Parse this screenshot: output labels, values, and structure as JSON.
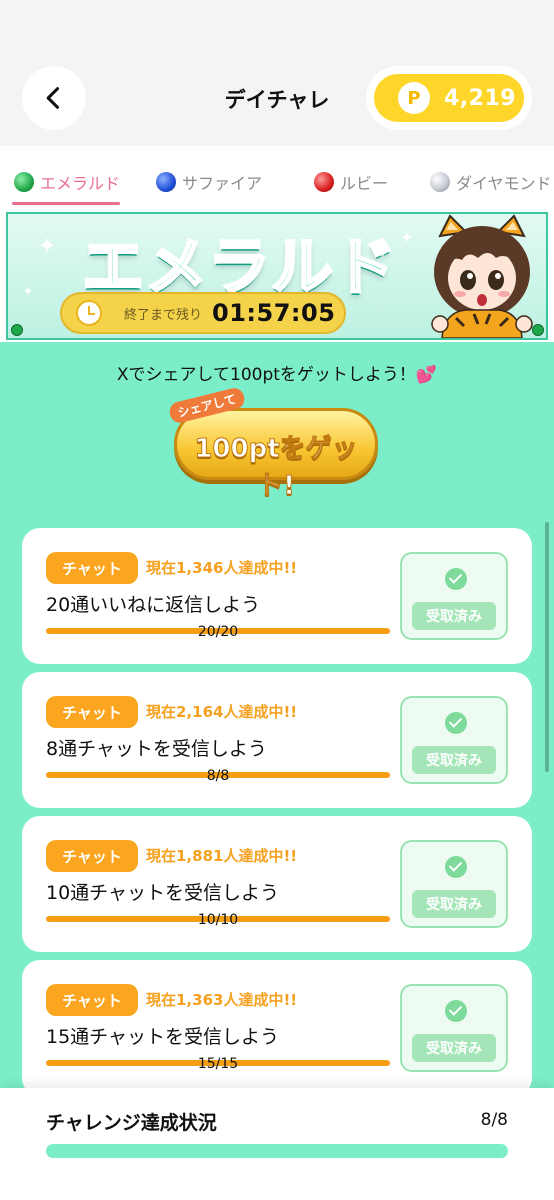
{
  "header": {
    "title": "デイチャレ",
    "back_icon": "chevron-left-icon",
    "points": {
      "icon": "P",
      "value": "4,219"
    }
  },
  "tabs": [
    {
      "label": "エメラルド",
      "gem_color": "#1fa84a",
      "active": true
    },
    {
      "label": "サファイア",
      "gem_color": "#1f4fd6",
      "active": false
    },
    {
      "label": "ルビー",
      "gem_color": "#d81e1e",
      "active": false
    },
    {
      "label": "ダイヤモンド",
      "gem_color": "#b8bcc4",
      "active": false
    }
  ],
  "banner": {
    "title": "エメラルド",
    "timer_label": "終了まで残り",
    "timer_value": "01:57:05"
  },
  "share": {
    "text": "Xでシェアして100ptをゲットしよう！💕",
    "button_small": "シェアして",
    "button_main": "100ptをゲット!"
  },
  "missions": [
    {
      "badge": "チャット",
      "achieved": "現在1,346人達成中!!",
      "task": "20通いいねに返信しよう",
      "progress_label": "20/20",
      "progress": 1.0,
      "claim_label": "受取済み"
    },
    {
      "badge": "チャット",
      "achieved": "現在2,164人達成中!!",
      "task": "8通チャットを受信しよう",
      "progress_label": "8/8",
      "progress": 1.0,
      "claim_label": "受取済み"
    },
    {
      "badge": "チャット",
      "achieved": "現在1,881人達成中!!",
      "task": "10通チャットを受信しよう",
      "progress_label": "10/10",
      "progress": 1.0,
      "claim_label": "受取済み"
    },
    {
      "badge": "チャット",
      "achieved": "現在1,363人達成中!!",
      "task": "15通チャットを受信しよう",
      "progress_label": "15/15",
      "progress": 1.0,
      "claim_label": "受取済み"
    }
  ],
  "footer": {
    "label": "チャレンジ達成状況",
    "value": "8/8",
    "progress": 1.0
  },
  "colors": {
    "accent_pink": "#ea6f8f",
    "mint_background": "#7beec9",
    "orange": "#fba520",
    "points_yellow": "#fed629",
    "claimed_green": "#a5e6b8"
  }
}
